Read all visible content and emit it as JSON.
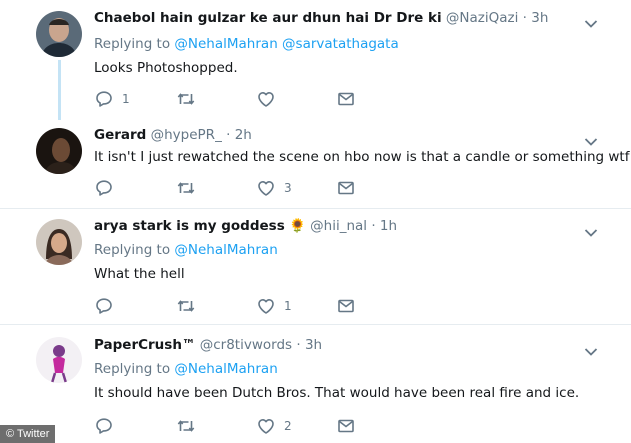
{
  "tweets": [
    {
      "name": "Chaebol hain gulzar ke aur dhun hai Dr Dre ki",
      "handle": "@NaziQazi",
      "dot": "·",
      "time": "3h",
      "replying_prefix": "Replying to",
      "replying_to": "@NehalMahran @sarvatathagata",
      "text": "Looks Photoshopped.",
      "reply_count": "1",
      "retweet_count": "",
      "like_count": ""
    },
    {
      "name": "Gerard",
      "handle": "@hypePR_",
      "dot": "·",
      "time": "2h",
      "text": "It isn't I just rewatched the scene on hbo now is that a candle or something wtf",
      "reply_count": "",
      "retweet_count": "",
      "like_count": "3"
    },
    {
      "name": "arya stark is my goddess",
      "emoji": "🌻",
      "handle": "@hii_nal",
      "dot": "·",
      "time": "1h",
      "replying_prefix": "Replying to",
      "replying_to": "@NehalMahran",
      "text": "What the hell",
      "reply_count": "",
      "retweet_count": "",
      "like_count": "1"
    },
    {
      "name": "PaperCrush™",
      "handle": "@cr8tivwords",
      "dot": "·",
      "time": "3h",
      "replying_prefix": "Replying to",
      "replying_to": "@NehalMahran",
      "text": "It should have been Dutch Bros. That would have been real fire and ice.",
      "reply_count": "",
      "retweet_count": "",
      "like_count": "2"
    }
  ],
  "credit": "© Twitter",
  "colors": {
    "link": "#1da1f2",
    "muted": "#657786",
    "text": "#14171a",
    "divider": "#e6ecf0"
  },
  "icons": [
    "reply-icon",
    "retweet-icon",
    "like-icon",
    "message-icon",
    "chevron-down-icon"
  ]
}
